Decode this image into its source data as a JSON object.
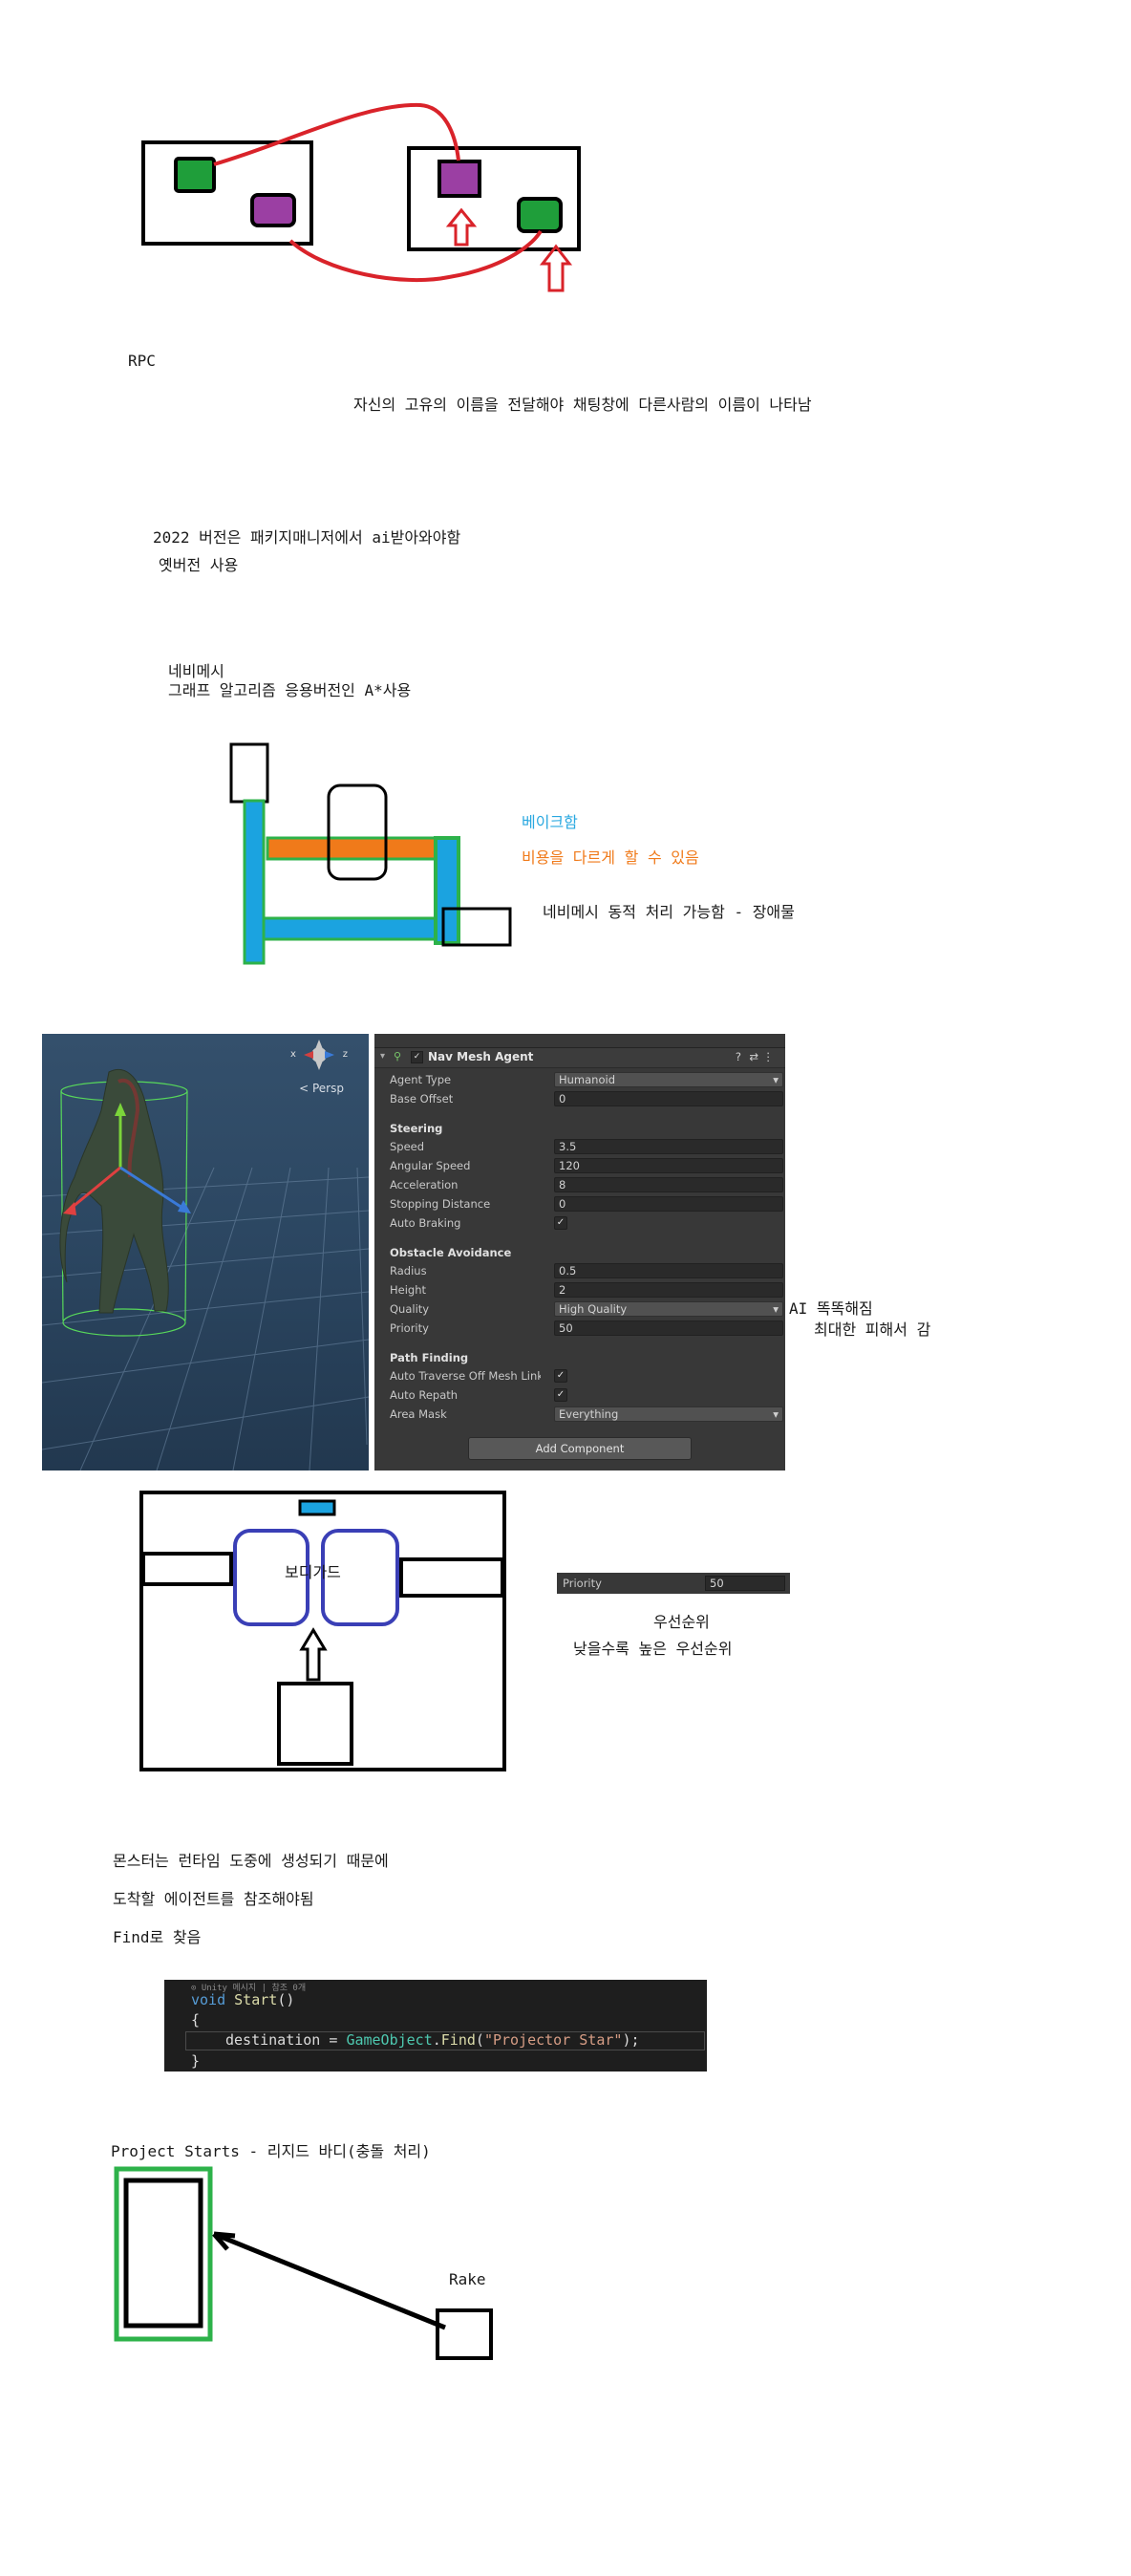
{
  "rpc_section": {
    "title": "RPC",
    "note": "자신의 고유의 이름을 전달해야 채팅창에 다른사람의 이름이 나타남"
  },
  "ai_package": {
    "line1": "2022 버전은 패키지매니저에서 ai받아와야함",
    "line2": "옛버전 사용"
  },
  "navmesh_intro": {
    "line1": "네비메시",
    "line2": "그래프 알고리즘 응용버전인 A*사용"
  },
  "navmesh_notes": {
    "bake": "베이크함",
    "cost": "비용을 다르게 할 수 있음",
    "dynamic": "네비메시 동적 처리 가능함 - 장애물",
    "colors": {
      "bake": "#29a8e0",
      "cost": "#f07a1a"
    }
  },
  "scene_view": {
    "persp_label": "< Persp",
    "gizmo_axes": [
      "x",
      "z"
    ]
  },
  "nav_mesh_agent": {
    "component_title": "Nav Mesh Agent",
    "header_icons": [
      "help-icon",
      "preset-icon",
      "more-icon"
    ],
    "agent_type_label": "Agent Type",
    "agent_type_value": "Humanoid",
    "base_offset_label": "Base Offset",
    "base_offset_value": "0",
    "steering": {
      "title": "Steering",
      "speed_label": "Speed",
      "speed_value": "3.5",
      "angular_speed_label": "Angular Speed",
      "angular_speed_value": "120",
      "acceleration_label": "Acceleration",
      "acceleration_value": "8",
      "stopping_distance_label": "Stopping Distance",
      "stopping_distance_value": "0",
      "auto_braking_label": "Auto Braking",
      "auto_braking_checked": true
    },
    "obstacle_avoidance": {
      "title": "Obstacle Avoidance",
      "radius_label": "Radius",
      "radius_value": "0.5",
      "height_label": "Height",
      "height_value": "2",
      "quality_label": "Quality",
      "quality_value": "High Quality",
      "priority_label": "Priority",
      "priority_value": "50"
    },
    "path_finding": {
      "title": "Path Finding",
      "auto_traverse_label": "Auto Traverse Off Mesh Link",
      "auto_traverse_checked": true,
      "auto_repath_label": "Auto Repath",
      "auto_repath_checked": true,
      "area_mask_label": "Area Mask",
      "area_mask_value": "Everything"
    },
    "add_component_label": "Add Component"
  },
  "quality_note": {
    "line1": "AI 똑똑해짐",
    "line2": "최대한 피해서 감"
  },
  "bodyguard": {
    "label": "보디가드"
  },
  "priority_widget": {
    "label": "Priority",
    "value": "50",
    "note1": "우선순위",
    "note2": "낮을수록 높은 우선순위"
  },
  "monster_notes": {
    "line1": "몬스터는 런타임 도중에 생성되기 때문에",
    "line2": "도착할 에이전트를 참조해야됨",
    "line3": "Find로 찾음"
  },
  "code": {
    "hint": "⊙ Unity 메시지 | 참조 0개",
    "line1_kw": "void",
    "line1_fn": "Start",
    "line1_rest": "()",
    "line2": "{",
    "line3_var": "destination = ",
    "line3_type": "GameObject",
    "line3_dot": ".",
    "line3_fn": "Find",
    "line3_str": "\"Projector Star\"",
    "line3_end": ");",
    "line4": "}"
  },
  "projector": {
    "title": "Project Starts - 리지드 바디(충돌 처리)",
    "rake_label": "Rake"
  }
}
